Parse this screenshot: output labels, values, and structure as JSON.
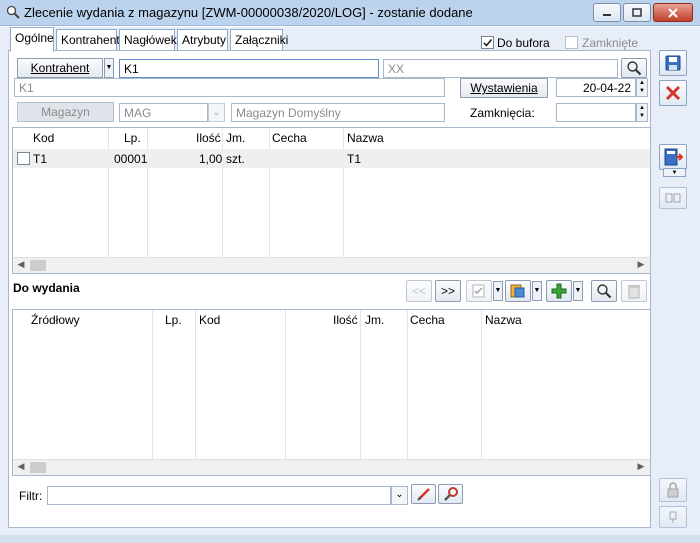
{
  "window": {
    "title": "Zlecenie wydania z magazynu [ZWM-00000038/2020/LOG]  - zostanie dodane"
  },
  "tabs": [
    {
      "label": "Ogólne"
    },
    {
      "label": "Kontrahent"
    },
    {
      "label": "Nagłówek"
    },
    {
      "label": "Atrybuty"
    },
    {
      "label": "Załączniki"
    }
  ],
  "flags": {
    "do_bufora_label": "Do bufora",
    "do_bufora_checked": true,
    "zamkniete_label": "Zamknięte",
    "zamkniete_checked": false
  },
  "header": {
    "kontrahent_button": "Kontrahent",
    "kontrahent_code": "K1",
    "kontrahent_name_placeholder": "XX",
    "kontrahent_name_line": "K1",
    "wystawienia_button": "Wystawienia",
    "wystawienia_date": "20-04-22",
    "magazyn_button": "Magazyn",
    "magazyn_code": "MAG",
    "magazyn_name": "Magazyn Domyślny",
    "zamkniecia_label": "Zamknięcia:",
    "zamkniecia_date": ""
  },
  "items_table": {
    "columns": [
      "Kod",
      "Lp.",
      "Ilość",
      "Jm.",
      "Cecha",
      "Nazwa"
    ],
    "rows": [
      {
        "kod": "T1",
        "lp": "00001",
        "ilosc": "1,00",
        "jm": "szt.",
        "cecha": "",
        "nazwa": "T1"
      }
    ]
  },
  "do_wydania": {
    "label": "Do wydania",
    "prev_label": "<<",
    "next_label": ">>"
  },
  "source_table": {
    "columns": [
      "Źródłowy",
      "Lp.",
      "Kod",
      "Ilość",
      "Jm.",
      "Cecha",
      "Nazwa"
    ],
    "rows": []
  },
  "filter": {
    "label": "Filtr:",
    "value": ""
  },
  "colors": {
    "titlebar": "#bcd3ee",
    "tab_border": "#8fa7c8",
    "row_highlight": "#efefef",
    "red_x": "#d9342b",
    "green_plus": "#3aa33a"
  }
}
